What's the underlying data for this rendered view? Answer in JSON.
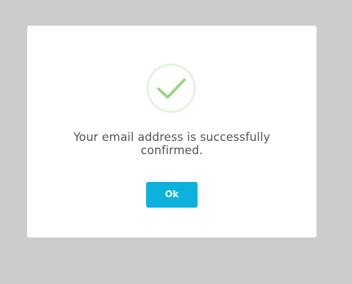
{
  "dialog": {
    "message": "Your email address is successfully confirmed.",
    "ok_label": "Ok",
    "icon": "checkmark-icon"
  },
  "colors": {
    "backdrop": "#cccccc",
    "dialog_background": "#ffffff",
    "success_ring": "#e3f3da",
    "success_check": "#9bd57e",
    "button_background": "#0cb2dc",
    "button_text": "#ffffff",
    "message_text": "#545454"
  }
}
